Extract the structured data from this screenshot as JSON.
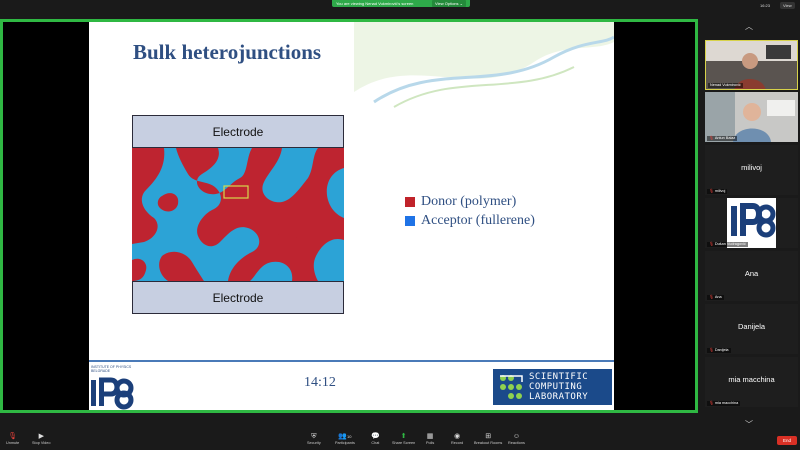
{
  "banner": {
    "message": "You are viewing Nenad Vukmirović's screen",
    "view_options": "View Options ⌄"
  },
  "top_bar": {
    "time": "16:23",
    "view_label": "View"
  },
  "slide": {
    "title": "Bulk heterojunctions",
    "electrode_top": "Electrode",
    "electrode_bottom": "Electrode",
    "legend": [
      {
        "label": "Donor (polymer)",
        "color": "#c0232a"
      },
      {
        "label": "Acceptor (fullerene)",
        "color": "#1f73e6"
      }
    ],
    "morphology_colors": {
      "donor": "#be2430",
      "acceptor": "#2ca3d6",
      "highlight": "#d6d94a"
    },
    "footer": {
      "ipb_caption": "INSTITUTE OF PHYSICS BELGRADE",
      "ipb_logo_text": "IPB",
      "time": "14:12",
      "scl_line1": "SCIENTIFIC",
      "scl_line2": "COMPUTING",
      "scl_line3": "LABORATORY"
    }
  },
  "participants": [
    {
      "name": "Nenad Vukmirović",
      "type": "video"
    },
    {
      "name": "Antun Balaz",
      "type": "video"
    },
    {
      "name": "milivoj",
      "display": "milivoj",
      "type": "name"
    },
    {
      "name": "Dušan Vudragović",
      "display": "IPB",
      "type": "logo"
    },
    {
      "name": "Ana",
      "display": "Ana",
      "type": "name"
    },
    {
      "name": "Danijela",
      "display": "Danijela",
      "type": "name"
    },
    {
      "name": "mia macchina",
      "display": "mia macchina",
      "type": "name"
    }
  ],
  "toolbar": {
    "unmute": "Unmute",
    "stop_video": "Stop Video",
    "security": "Security",
    "participants": "Participants",
    "participants_count": "10",
    "chat": "Chat",
    "share_screen": "Share Screen",
    "polls": "Polls",
    "record": "Record",
    "breakout_rooms": "Breakout Rooms",
    "reactions": "Reactions",
    "end": "End"
  },
  "colors": {
    "accent_green": "#2fb843",
    "end_red": "#d93025",
    "slide_blue": "#2f4f82"
  }
}
